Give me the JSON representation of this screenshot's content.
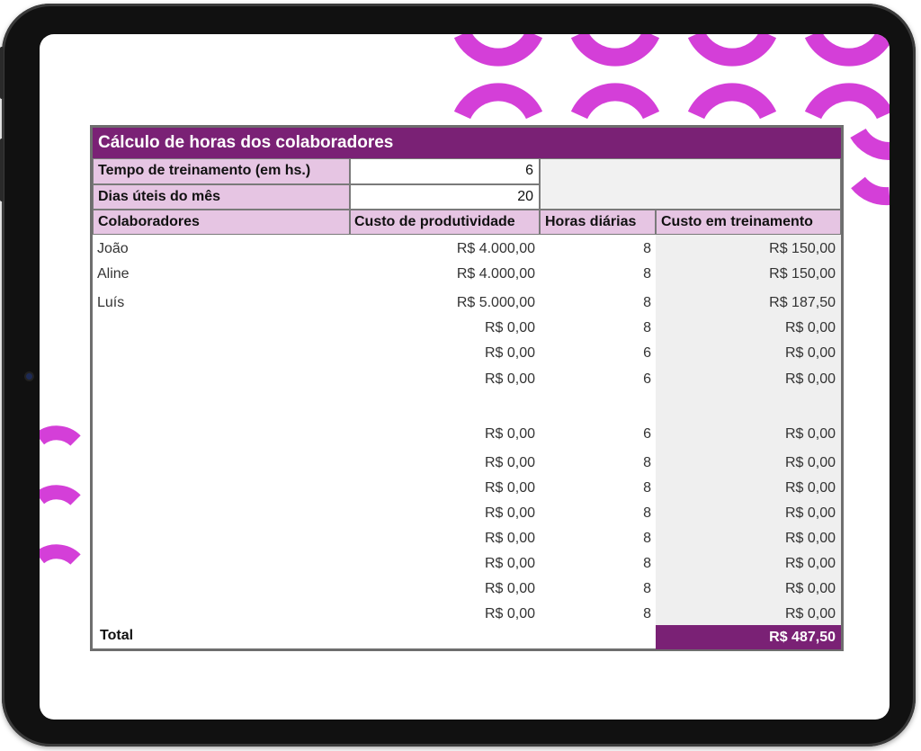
{
  "sheet": {
    "title": "Cálculo de horas dos colaboradores",
    "params": [
      {
        "label": "Tempo de treinamento (em hs.)",
        "value": "6"
      },
      {
        "label": "Dias úteis do mês",
        "value": "20"
      }
    ],
    "headers": [
      "Colaboradores",
      "Custo de produtividade",
      "Horas diárias",
      "Custo em treinamento"
    ],
    "rows": [
      {
        "name": "João",
        "cost": "R$ 4.000,00",
        "hours": "8",
        "training": "R$ 150,00"
      },
      {
        "name": "Aline",
        "cost": "R$ 4.000,00",
        "hours": "8",
        "training": "R$ 150,00"
      },
      {
        "name": "Luís",
        "cost": "R$ 5.000,00",
        "hours": "8",
        "training": "R$ 187,50"
      },
      {
        "name": "",
        "cost": "R$ 0,00",
        "hours": "8",
        "training": "R$ 0,00"
      },
      {
        "name": "",
        "cost": "R$ 0,00",
        "hours": "6",
        "training": "R$ 0,00"
      },
      {
        "name": "",
        "cost": "R$ 0,00",
        "hours": "6",
        "training": "R$ 0,00"
      },
      {
        "name": "",
        "cost": "R$ 0,00",
        "hours": "6",
        "training": "R$ 0,00"
      },
      {
        "name": "",
        "cost": "R$ 0,00",
        "hours": "8",
        "training": "R$ 0,00"
      },
      {
        "name": "",
        "cost": "R$ 0,00",
        "hours": "8",
        "training": "R$ 0,00"
      },
      {
        "name": "",
        "cost": "R$ 0,00",
        "hours": "8",
        "training": "R$ 0,00"
      },
      {
        "name": "",
        "cost": "R$ 0,00",
        "hours": "8",
        "training": "R$ 0,00"
      },
      {
        "name": "",
        "cost": "R$ 0,00",
        "hours": "8",
        "training": "R$ 0,00"
      },
      {
        "name": "",
        "cost": "R$ 0,00",
        "hours": "8",
        "training": "R$ 0,00"
      },
      {
        "name": "",
        "cost": "R$ 0,00",
        "hours": "8",
        "training": "R$ 0,00"
      }
    ],
    "total_label": "Total",
    "total_value": "R$ 487,50"
  },
  "colors": {
    "accent": "#7a2175",
    "header_bg": "#e6c5e3",
    "decoration": "#d43fd8"
  }
}
